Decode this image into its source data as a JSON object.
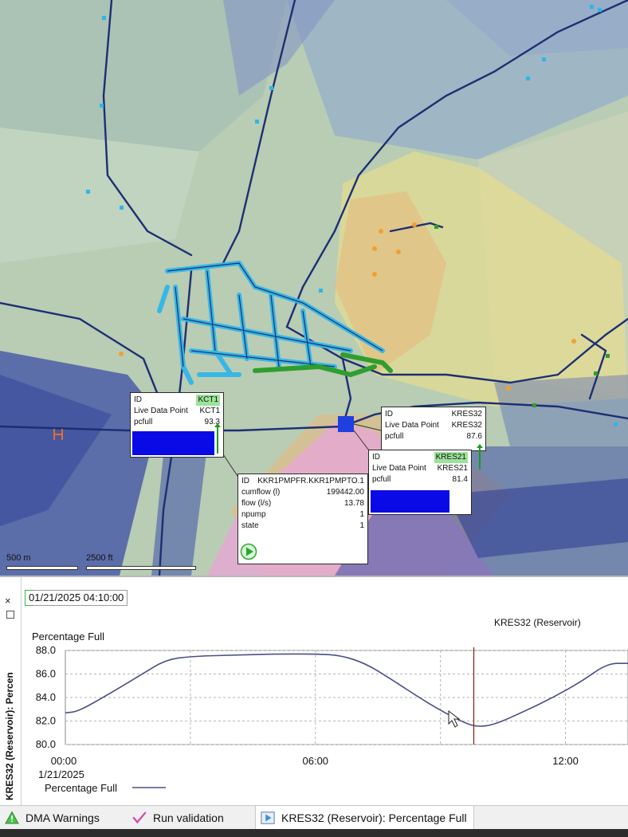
{
  "map": {
    "popups": {
      "kct1": {
        "rows": [
          {
            "k": "ID",
            "v": "KCT1"
          },
          {
            "k": "Live Data Point",
            "v": "KCT1"
          },
          {
            "k": "pcfull",
            "v": "93.3"
          }
        ],
        "fill_fraction": 0.933
      },
      "kres32": {
        "rows": [
          {
            "k": "ID",
            "v": "KRES32"
          },
          {
            "k": "Live Data Point",
            "v": "KRES32"
          },
          {
            "k": "pcfull",
            "v": "87.6"
          }
        ],
        "fill_fraction": 0.876
      },
      "kres21": {
        "rows": [
          {
            "k": "ID",
            "v": "KRES21"
          },
          {
            "k": "Live Data Point",
            "v": "KRES21"
          },
          {
            "k": "pcfull",
            "v": "81.4"
          }
        ],
        "fill_fraction": 0.814
      },
      "pump": {
        "rows": [
          {
            "k": "ID",
            "v": "KKR1PMPFR.KKR1PMPTO.1"
          },
          {
            "k": "cumflow (l)",
            "v": "199442.00"
          },
          {
            "k": "flow (l/s)",
            "v": "13.78"
          },
          {
            "k": "npump",
            "v": "1"
          },
          {
            "k": "state",
            "v": "1"
          }
        ]
      }
    },
    "scale": {
      "metric": "500 m",
      "imperial": "2500 ft"
    },
    "colors": {
      "pipe": "#1c2f73",
      "dma_pipe": "#2fb6e8",
      "green_pipe": "#2e9e2e",
      "bar": "#0a0ae6",
      "pink_zone": "#e7a6d6",
      "orange_zone": "#e9b87c",
      "yellow_zone": "#e6dd8e"
    }
  },
  "chart_panel": {
    "side_title": "KRES32 (Reservoir): Percen",
    "close_glyph": "×",
    "timestamp": "01/21/2025 04:10:00",
    "chart_title": "KRES32 (Reservoir)"
  },
  "chart_data": {
    "type": "line",
    "ylabel": "Percentage Full",
    "ylim": [
      80.0,
      88.0
    ],
    "y_ticks": [
      "80.0",
      "82.0",
      "84.0",
      "86.0",
      "88.0"
    ],
    "x_ticks": [
      "00:00",
      "06:00",
      "12:00"
    ],
    "x_date": "1/21/2025",
    "x_range_hours": [
      0,
      13.5
    ],
    "cursor_hour": 9.8,
    "series": [
      {
        "name": "Percentage Full",
        "x": [
          0,
          0.3,
          1.0,
          1.8,
          2.4,
          3.0,
          4.0,
          5.0,
          6.0,
          6.6,
          7.2,
          7.8,
          8.4,
          9.0,
          9.6,
          9.9,
          10.3,
          11.0,
          11.7,
          12.4,
          13.0,
          13.5
        ],
        "y": [
          82.7,
          82.8,
          84.2,
          85.9,
          87.2,
          87.5,
          87.6,
          87.7,
          87.7,
          87.6,
          86.9,
          85.6,
          84.2,
          82.9,
          81.8,
          81.5,
          81.7,
          82.8,
          84.0,
          85.4,
          86.9,
          86.9
        ]
      }
    ],
    "line_color": "#4a4e8c",
    "cursor_color": "#8b1a1a",
    "grid": true,
    "legend": "bottom-left"
  },
  "tabs": [
    {
      "label": "DMA Warnings",
      "icon": "warning-icon"
    },
    {
      "label": "Run validation",
      "icon": "checkmark-icon"
    },
    {
      "label": "KRES32 (Reservoir): Percentage Full",
      "icon": "play-icon",
      "active": true
    }
  ]
}
